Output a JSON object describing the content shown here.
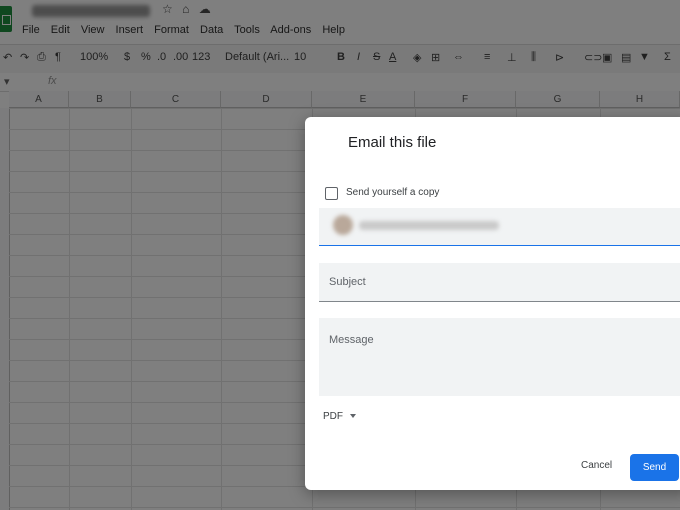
{
  "menu": [
    "File",
    "Edit",
    "View",
    "Insert",
    "Format",
    "Data",
    "Tools",
    "Add-ons",
    "Help"
  ],
  "toolbar": {
    "zoom": "100%",
    "currency": "$",
    "percent": "%",
    "dec_decrease": ".0",
    "dec_increase": ".00",
    "more_formats": "123",
    "font": "Default (Ari...",
    "font_size": "10",
    "bold": "B",
    "italic": "I",
    "strikethrough": "S",
    "text_color": "A",
    "sum": "Σ"
  },
  "formula_bar": {
    "fx": "fx"
  },
  "columns": [
    "A",
    "B",
    "C",
    "D",
    "E",
    "F",
    "G",
    "H"
  ],
  "dialog": {
    "title": "Email this file",
    "send_copy_label": "Send yourself a copy",
    "subject_placeholder": "Subject",
    "message_placeholder": "Message",
    "format": "PDF",
    "cancel_label": "Cancel",
    "send_label": "Send",
    "accent_color": "#1a73e8"
  }
}
